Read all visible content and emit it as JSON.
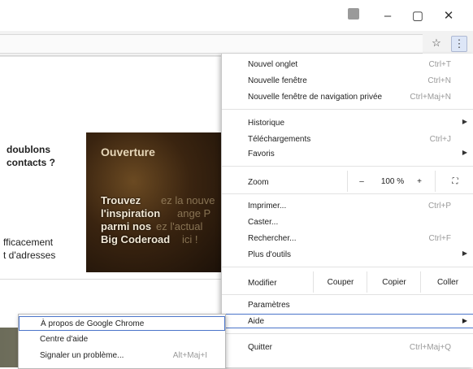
{
  "window_controls": {
    "minimize": "–",
    "maximize": "▢",
    "close": "✕"
  },
  "toolbar": {
    "star_icon": "☆",
    "menu_icon": "⋮"
  },
  "page": {
    "card_title_line1": "doublons",
    "card_title_line2": "contacts ?",
    "card_body_line1": "fficacement",
    "card_body_line2": "t d'adresses",
    "banner": {
      "title": "Ouverture",
      "lines": [
        "Trouvez",
        "l'inspiration",
        "parmi nos",
        "Big Coderoad"
      ],
      "ghost": [
        "ez la nouve",
        "ange P",
        "ez l'actual",
        "ici !"
      ]
    }
  },
  "menu": {
    "items": [
      {
        "label": "Nouvel onglet",
        "shortcut": "Ctrl+T"
      },
      {
        "label": "Nouvelle fenêtre",
        "shortcut": "Ctrl+N"
      },
      {
        "label": "Nouvelle fenêtre de navigation privée",
        "shortcut": "Ctrl+Maj+N"
      },
      {
        "label": "Historique",
        "shortcut": ""
      },
      {
        "label": "Téléchargements",
        "shortcut": "Ctrl+J"
      },
      {
        "label": "Favoris",
        "shortcut": ""
      },
      {
        "label": "Imprimer...",
        "shortcut": "Ctrl+P"
      },
      {
        "label": "Caster...",
        "shortcut": ""
      },
      {
        "label": "Rechercher...",
        "shortcut": "Ctrl+F"
      },
      {
        "label": "Plus d'outils",
        "shortcut": ""
      },
      {
        "label": "Paramètres",
        "shortcut": ""
      },
      {
        "label": "Aide",
        "shortcut": ""
      },
      {
        "label": "Quitter",
        "shortcut": "Ctrl+Maj+Q"
      }
    ],
    "zoom": {
      "label": "Zoom",
      "minus": "–",
      "value": "100 %",
      "plus": "+",
      "fullscreen": "⛶"
    },
    "edit": {
      "label": "Modifier",
      "cut": "Couper",
      "copy": "Copier",
      "paste": "Coller"
    }
  },
  "help_submenu": {
    "items": [
      {
        "label": "À propos de Google Chrome",
        "shortcut": ""
      },
      {
        "label": "Centre d'aide",
        "shortcut": ""
      },
      {
        "label": "Signaler un problème...",
        "shortcut": "Alt+Maj+I"
      }
    ]
  }
}
